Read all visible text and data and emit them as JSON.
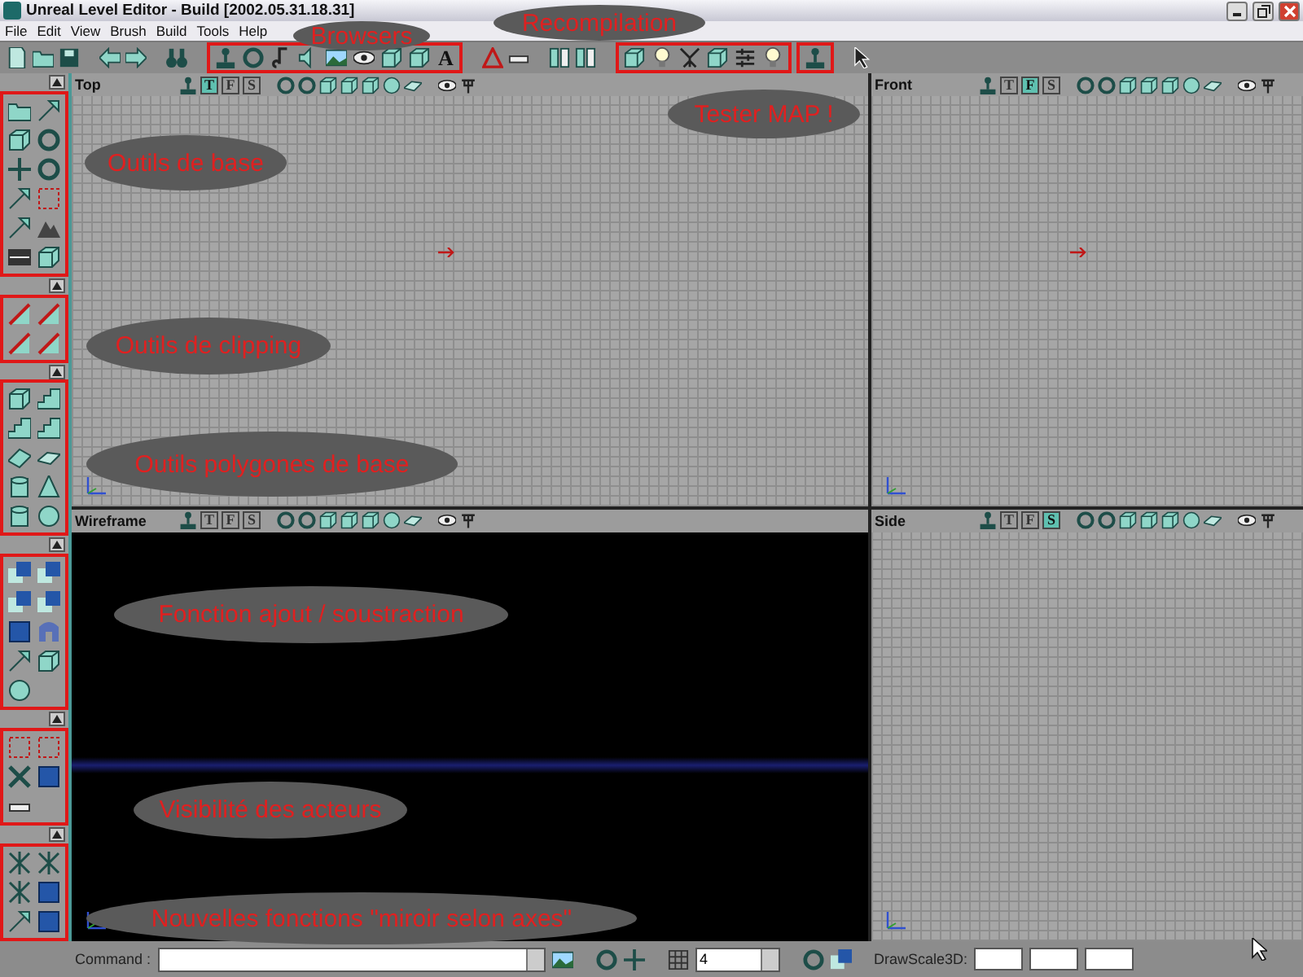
{
  "window": {
    "title": "Unreal Level Editor - Build [2002.05.31.18.31]"
  },
  "menu": [
    "File",
    "Edit",
    "View",
    "Brush",
    "Build",
    "Tools",
    "Help"
  ],
  "toolbar": {
    "font_glyph": "A"
  },
  "viewports": [
    {
      "title": "Top",
      "kind": "grid",
      "modes": [
        {
          "label": "T",
          "selected": true
        },
        {
          "label": "F",
          "selected": false
        },
        {
          "label": "S",
          "selected": false
        }
      ]
    },
    {
      "title": "Front",
      "kind": "grid",
      "modes": [
        {
          "label": "T",
          "selected": false
        },
        {
          "label": "F",
          "selected": true
        },
        {
          "label": "S",
          "selected": false
        }
      ]
    },
    {
      "title": "Wireframe",
      "kind": "wireframe",
      "modes": [
        {
          "label": "T",
          "selected": false
        },
        {
          "label": "F",
          "selected": false
        },
        {
          "label": "S",
          "selected": false
        }
      ]
    },
    {
      "title": "Side",
      "kind": "grid",
      "modes": [
        {
          "label": "T",
          "selected": false
        },
        {
          "label": "F",
          "selected": false
        },
        {
          "label": "S",
          "selected": true
        }
      ]
    }
  ],
  "command_bar": {
    "label": "Command :",
    "grid_size": "4",
    "drawscale_label": "DrawScale3D:"
  },
  "annotations": [
    "Browsers",
    "Recompilation",
    "Tester MAP !",
    "Outils de base",
    "Outils de clipping",
    "Outils polygones de base",
    "Fonction ajout / soustraction",
    "Visibilité des acteurs",
    "Nouvelles fonctions \"miroir selon axes\""
  ]
}
